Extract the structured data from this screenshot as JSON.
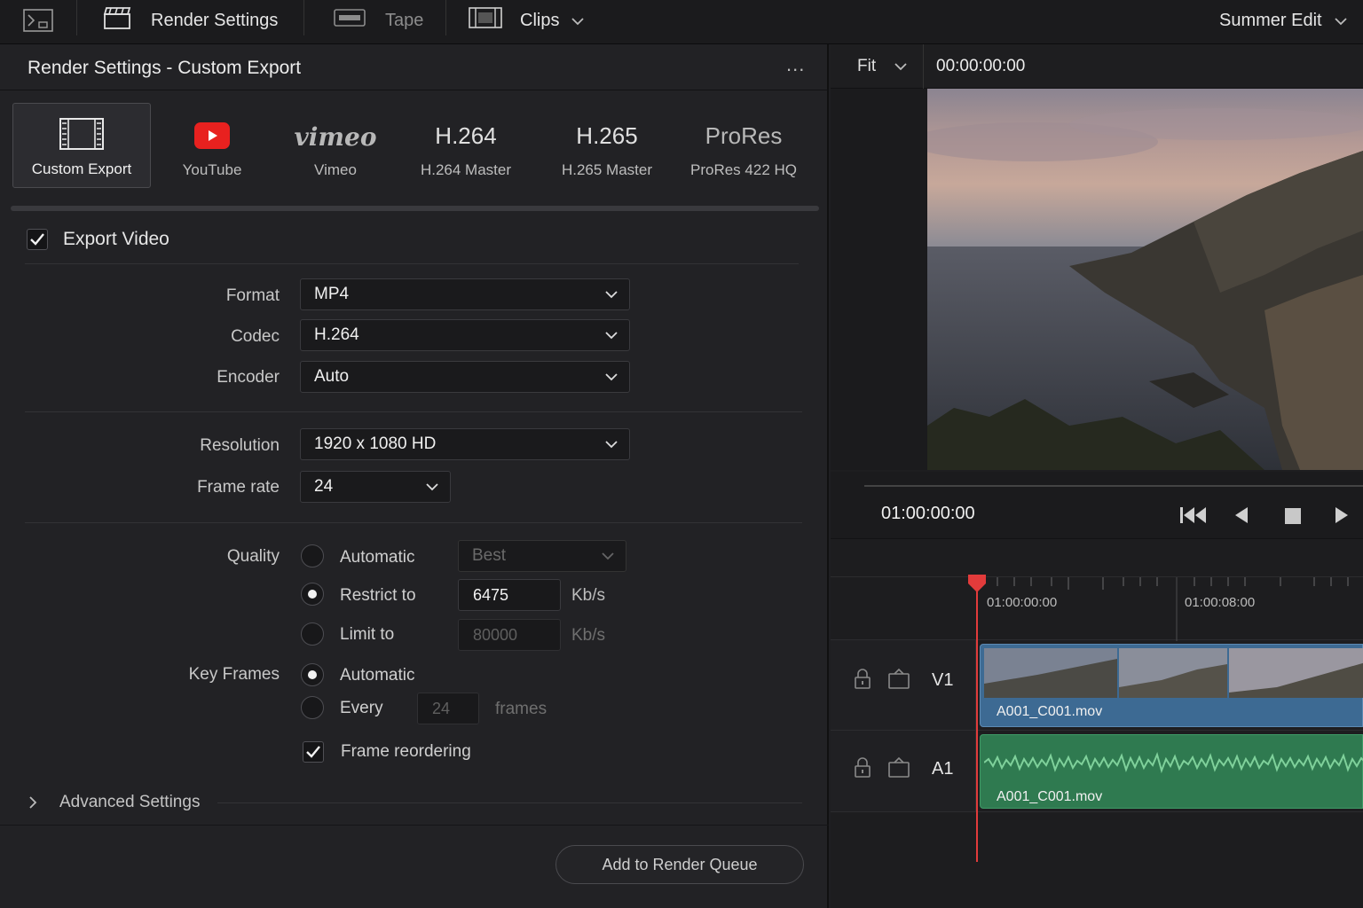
{
  "topbar": {
    "render_settings": "Render Settings",
    "tape": "Tape",
    "clips": "Clips",
    "project": "Summer Edit"
  },
  "panel": {
    "title": "Render Settings - Custom Export",
    "more": "..."
  },
  "presets": [
    {
      "big": "",
      "label": "Custom Export"
    },
    {
      "big": "",
      "label": "YouTube"
    },
    {
      "big": "vimeo",
      "label": "Vimeo"
    },
    {
      "big": "H.264",
      "label": "H.264 Master"
    },
    {
      "big": "H.265",
      "label": "H.265 Master"
    },
    {
      "big": "ProRes",
      "label": "ProRes 422 HQ"
    }
  ],
  "export_video": {
    "label": "Export Video",
    "checked": true
  },
  "format": {
    "label": "Format",
    "value": "MP4"
  },
  "codec": {
    "label": "Codec",
    "value": "H.264"
  },
  "encoder": {
    "label": "Encoder",
    "value": "Auto"
  },
  "resolution": {
    "label": "Resolution",
    "value": "1920 x 1080 HD"
  },
  "frame_rate": {
    "label": "Frame rate",
    "value": "24"
  },
  "quality": {
    "label": "Quality",
    "automatic": "Automatic",
    "automatic_value": "Best",
    "restrict": "Restrict to",
    "restrict_value": "6475",
    "restrict_unit": "Kb/s",
    "limit": "Limit to",
    "limit_value": "80000",
    "limit_unit": "Kb/s",
    "selected": "Restrict to"
  },
  "key_frames": {
    "label": "Key Frames",
    "automatic": "Automatic",
    "every": "Every",
    "every_value": "24",
    "every_unit": "frames",
    "selected": "Automatic"
  },
  "frame_reordering": {
    "label": "Frame reordering",
    "checked": true
  },
  "advanced": {
    "label": "Advanced Settings"
  },
  "add_to_queue": "Add to Render Queue",
  "viewer": {
    "zoom": "Fit",
    "timecode": "00:00:00:00",
    "transport_timecode": "01:00:00:00"
  },
  "timeline": {
    "ruler_labels": [
      "01:00:00:00",
      "01:00:08:00"
    ],
    "tracks": [
      {
        "name": "V1",
        "clip": "A001_C001.mov",
        "type": "video"
      },
      {
        "name": "A1",
        "clip": "A001_C001.mov",
        "type": "audio"
      }
    ]
  },
  "colors": {
    "playhead": "#e23b3b",
    "video_clip": "#3d6a93",
    "audio_clip": "#2f7a50",
    "youtube_red": "#e8211f"
  }
}
